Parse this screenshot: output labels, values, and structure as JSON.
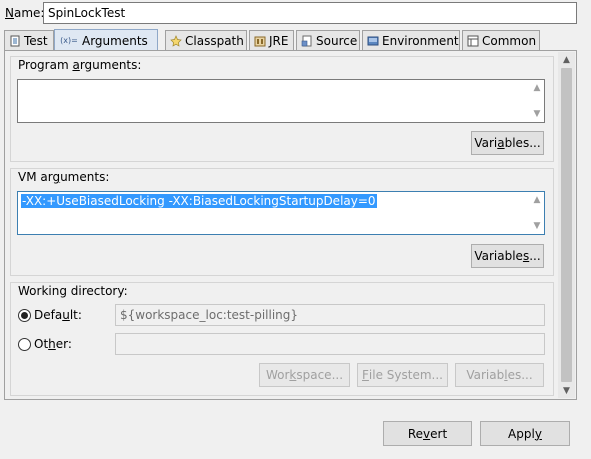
{
  "name_row": {
    "label": "Name:",
    "value": "SpinLockTest"
  },
  "tabs": [
    {
      "label": "Test",
      "icon": "test-icon",
      "active": false
    },
    {
      "label": "Arguments",
      "icon": "arguments-icon",
      "active": true
    },
    {
      "label": "Classpath",
      "icon": "classpath-icon",
      "active": false
    },
    {
      "label": "JRE",
      "icon": "jre-icon",
      "active": false
    },
    {
      "label": "Source",
      "icon": "source-icon",
      "active": false
    },
    {
      "label": "Environment",
      "icon": "environment-icon",
      "active": false
    },
    {
      "label": "Common",
      "icon": "common-icon",
      "active": false
    }
  ],
  "program_arguments": {
    "title": "Program arguments:",
    "value": "",
    "variables_button": "Variables..."
  },
  "vm_arguments": {
    "title": "VM arguments:",
    "value": "-XX:+UseBiasedLocking -XX:BiasedLockingStartupDelay=0",
    "variables_button": "Variables..."
  },
  "working_directory": {
    "title": "Working directory:",
    "default_label": "Default:",
    "default_value": "${workspace_loc:test-pilling}",
    "other_label": "Other:",
    "other_value": "",
    "selected": "default",
    "workspace_button": "Workspace...",
    "file_system_button": "File System...",
    "variables_button": "Variables..."
  },
  "footer": {
    "revert_button": "Revert",
    "apply_button": "Apply"
  },
  "colors": {
    "selection": "#3399ff",
    "active_tab": "#dfe8f3",
    "focus_border": "#3c7fb1"
  }
}
